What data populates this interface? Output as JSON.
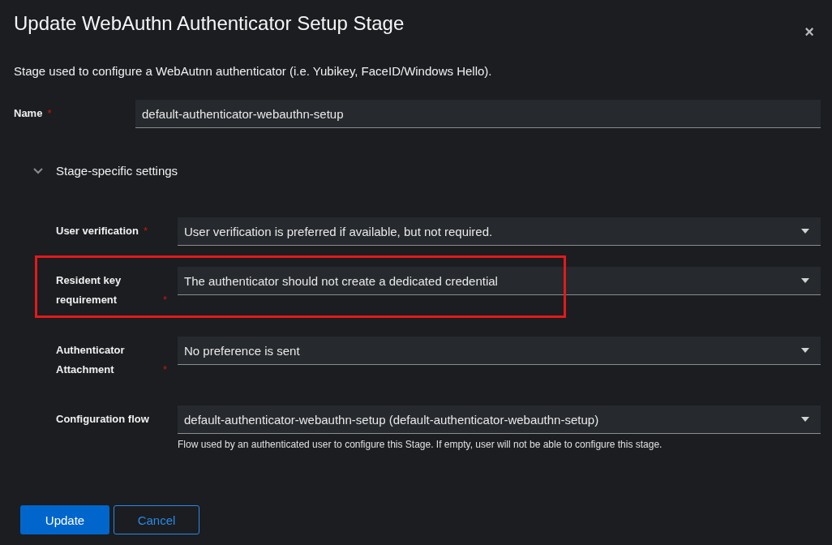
{
  "dialog": {
    "title": "Update WebAuthn Authenticator Setup Stage",
    "close": "×",
    "description": "Stage used to configure a WebAutnn authenticator (i.e. Yubikey, FaceID/Windows Hello).",
    "name_field": {
      "label": "Name",
      "required_mark": "*",
      "value": "default-authenticator-webauthn-setup"
    },
    "section": {
      "title": "Stage-specific settings",
      "expanded": true,
      "fields": [
        {
          "kind": "select",
          "label": "User verification",
          "required_mark": "*",
          "value": "User verification is preferred if available, but not required.",
          "highlighted": false
        },
        {
          "kind": "select",
          "label": "Resident key requirement",
          "required_mark": "*",
          "value": "The authenticator should not create a dedicated credential",
          "highlighted": true
        },
        {
          "kind": "select",
          "label": "Authenticator Attachment",
          "required_mark": "*",
          "value": "No preference is sent",
          "highlighted": false
        },
        {
          "kind": "select",
          "label": "Configuration flow",
          "value": "default-authenticator-webauthn-setup (default-authenticator-webauthn-setup)",
          "helper": "Flow used by an authenticated user to configure this Stage. If empty, user will not be able to configure this stage.",
          "highlighted": false
        }
      ]
    },
    "buttons": [
      {
        "kind": "primary",
        "label": "Update"
      },
      {
        "kind": "secondary",
        "label": "Cancel"
      }
    ]
  }
}
